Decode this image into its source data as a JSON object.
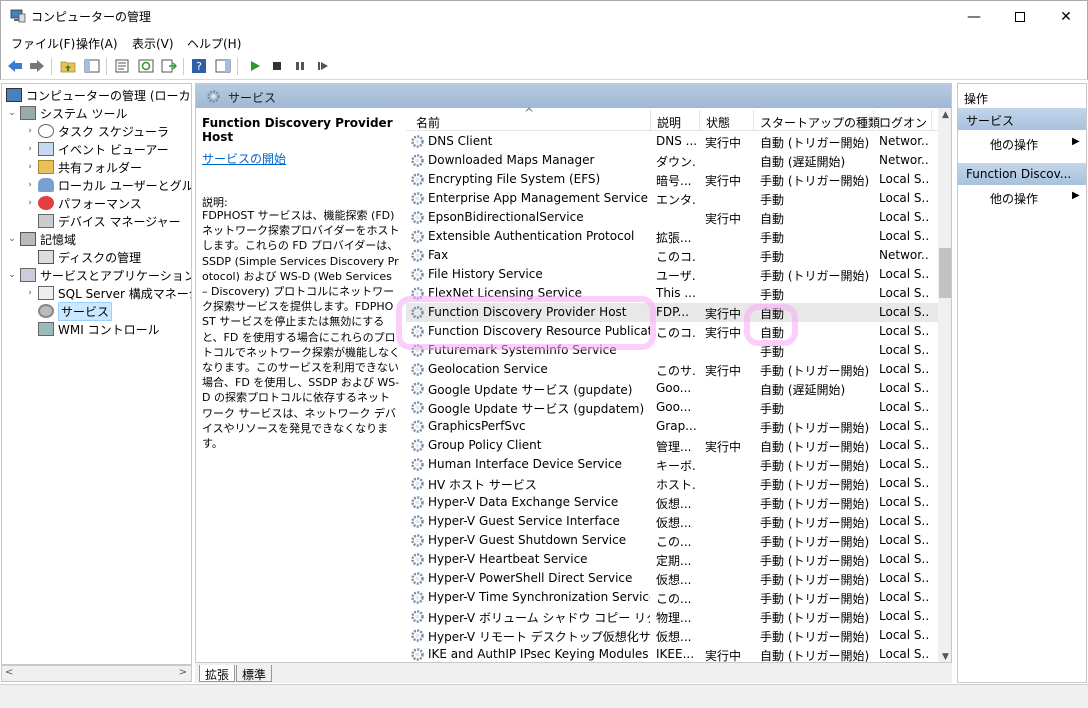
{
  "window": {
    "title": "コンピューターの管理"
  },
  "menu": [
    "ファイル(F)",
    "操作(A)",
    "表示(V)",
    "ヘルプ(H)"
  ],
  "tree": {
    "items": [
      {
        "label": "コンピューターの管理 (ローカル)",
        "icon": "computer-management-icon",
        "level": 0,
        "expander": ""
      },
      {
        "label": "システム ツール",
        "icon": "tools-icon",
        "level": 1,
        "expander": "⌄"
      },
      {
        "label": "タスク スケジューラ",
        "icon": "clock-icon",
        "level": 2,
        "expander": "›"
      },
      {
        "label": "イベント ビューアー",
        "icon": "event-viewer-icon",
        "level": 2,
        "expander": "›"
      },
      {
        "label": "共有フォルダー",
        "icon": "shared-folder-icon",
        "level": 2,
        "expander": "›"
      },
      {
        "label": "ローカル ユーザーとグループ",
        "icon": "users-icon",
        "level": 2,
        "expander": "›"
      },
      {
        "label": "パフォーマンス",
        "icon": "performance-icon",
        "level": 2,
        "expander": "›"
      },
      {
        "label": "デバイス マネージャー",
        "icon": "device-manager-icon",
        "level": 2,
        "expander": ""
      },
      {
        "label": "記憶域",
        "icon": "storage-icon",
        "level": 1,
        "expander": "⌄"
      },
      {
        "label": "ディスクの管理",
        "icon": "disk-icon",
        "level": 2,
        "expander": ""
      },
      {
        "label": "サービスとアプリケーション",
        "icon": "services-apps-icon",
        "level": 1,
        "expander": "⌄"
      },
      {
        "label": "SQL Server 構成マネージャ",
        "icon": "sql-icon",
        "level": 2,
        "expander": "›"
      },
      {
        "label": "サービス",
        "icon": "gear-icon",
        "level": 2,
        "expander": "",
        "selected": true
      },
      {
        "label": "WMI コントロール",
        "icon": "wmi-icon",
        "level": 2,
        "expander": ""
      }
    ]
  },
  "center": {
    "header": "サービス",
    "description": {
      "service_name": "Function Discovery Provider Host",
      "start_link": "サービスの開始",
      "label": "説明:",
      "text": "FDPHOST サービスは、機能探索 (FD) ネットワーク探索プロバイダーをホストします。これらの FD プロバイダーは、SSDP (Simple Services Discovery Protocol) および WS-D (Web Services – Discovery) プロトコルにネットワーク探索サービスを提供します。FDPHOST サービスを停止または無効にすると、FD を使用する場合にこれらのプロトコルでネットワーク探索が機能しなくなります。このサービスを利用できない場合、FD を使用し、SSDP および WS-D の探索プロトコルに依存するネットワーク サービスは、ネットワーク デバイスやリソースを発見できなくなります。"
    },
    "columns": [
      "名前",
      "説明",
      "状態",
      "スタートアップの種類",
      "ログオン"
    ],
    "sort_indicator": "^",
    "services": [
      [
        "DNS Client",
        "DNS ...",
        "実行中",
        "自動 (トリガー開始)",
        "Networ..."
      ],
      [
        "Downloaded Maps Manager",
        "ダウン...",
        "",
        "自動 (遅延開始)",
        "Networ..."
      ],
      [
        "Encrypting File System (EFS)",
        "暗号...",
        "実行中",
        "手動 (トリガー開始)",
        "Local S..."
      ],
      [
        "Enterprise App Management Service",
        "エンタ...",
        "",
        "手動",
        "Local S..."
      ],
      [
        "EpsonBidirectionalService",
        "",
        "実行中",
        "自動",
        "Local S..."
      ],
      [
        "Extensible Authentication Protocol",
        "拡張...",
        "",
        "手動",
        "Local S..."
      ],
      [
        "Fax",
        "このコ...",
        "",
        "手動",
        "Networ..."
      ],
      [
        "File History Service",
        "ユーザ...",
        "",
        "手動 (トリガー開始)",
        "Local S..."
      ],
      [
        "FlexNet Licensing Service",
        "This ...",
        "",
        "手動",
        "Local S..."
      ],
      [
        "Function Discovery Provider Host",
        "FDP...",
        "実行中",
        "自動",
        "Local S..."
      ],
      [
        "Function Discovery Resource Publication",
        "このコ...",
        "実行中",
        "自動",
        "Local S..."
      ],
      [
        "Futuremark SystemInfo Service",
        "",
        "",
        "手動",
        "Local S..."
      ],
      [
        "Geolocation Service",
        "このサ...",
        "実行中",
        "手動 (トリガー開始)",
        "Local S..."
      ],
      [
        "Google Update サービス (gupdate)",
        "Goo...",
        "",
        "自動 (遅延開始)",
        "Local S..."
      ],
      [
        "Google Update サービス (gupdatem)",
        "Goo...",
        "",
        "手動",
        "Local S..."
      ],
      [
        "GraphicsPerfSvc",
        "Grap...",
        "",
        "手動 (トリガー開始)",
        "Local S..."
      ],
      [
        "Group Policy Client",
        "管理...",
        "実行中",
        "自動 (トリガー開始)",
        "Local S..."
      ],
      [
        "Human Interface Device Service",
        "キーボ...",
        "",
        "手動 (トリガー開始)",
        "Local S..."
      ],
      [
        "HV ホスト サービス",
        "ホスト...",
        "",
        "手動 (トリガー開始)",
        "Local S..."
      ],
      [
        "Hyper-V Data Exchange Service",
        "仮想...",
        "",
        "手動 (トリガー開始)",
        "Local S..."
      ],
      [
        "Hyper-V Guest Service Interface",
        "仮想...",
        "",
        "手動 (トリガー開始)",
        "Local S..."
      ],
      [
        "Hyper-V Guest Shutdown Service",
        "この...",
        "",
        "手動 (トリガー開始)",
        "Local S..."
      ],
      [
        "Hyper-V Heartbeat Service",
        "定期...",
        "",
        "手動 (トリガー開始)",
        "Local S..."
      ],
      [
        "Hyper-V PowerShell Direct Service",
        "仮想...",
        "",
        "手動 (トリガー開始)",
        "Local S..."
      ],
      [
        "Hyper-V Time Synchronization Service",
        "この...",
        "",
        "手動 (トリガー開始)",
        "Local S..."
      ],
      [
        "Hyper-V ボリューム シャドウ コピー リクエスター",
        "物理...",
        "",
        "手動 (トリガー開始)",
        "Local S..."
      ],
      [
        "Hyper-V リモート デスクトップ仮想化サービス",
        "仮想...",
        "",
        "手動 (トリガー開始)",
        "Local S..."
      ],
      [
        "IKE and AuthIP IPsec Keying Modules",
        "IKEE...",
        "実行中",
        "自動 (トリガー開始)",
        "Local S..."
      ]
    ],
    "tabs": [
      "拡張",
      "標準"
    ]
  },
  "actions": {
    "header": "操作",
    "sections": [
      {
        "title": "サービス",
        "items": [
          "他の操作"
        ]
      },
      {
        "title": "Function Discov...",
        "items": [
          "他の操作"
        ]
      }
    ]
  },
  "colors": {
    "accent": "#cce8ff",
    "highlight": "#f5aaf5",
    "link": "#0066cc"
  }
}
